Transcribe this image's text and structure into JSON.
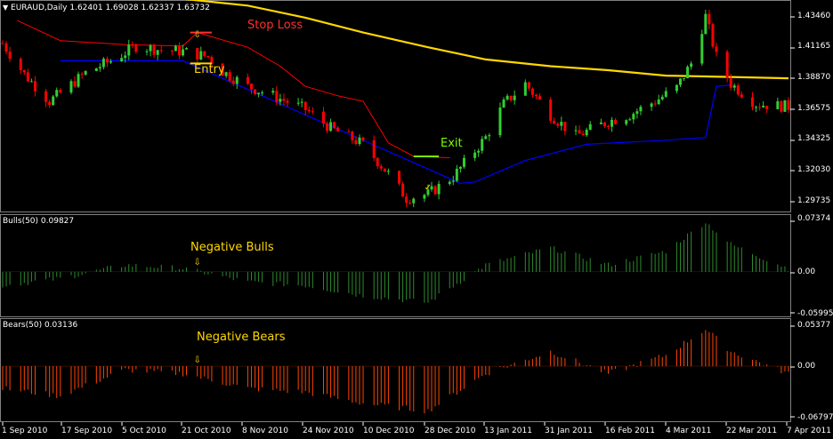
{
  "header": {
    "symbol_line": "EURAUD,Daily  1.62401 1.69028 1.62337 1.63732",
    "bulls_label": "Bulls(50) 0.09827",
    "bears_label": "Bears(50) 0.03136"
  },
  "annotations": {
    "stop_loss": "Stop Loss",
    "entry": "Entry",
    "exit": "Exit",
    "negative_bulls": "Negative Bulls",
    "negative_bears": "Negative Bears"
  },
  "price_axis": [
    "1.43460",
    "1.41165",
    "1.38870",
    "1.36575",
    "1.34325",
    "1.32030",
    "1.29735"
  ],
  "bulls_axis": [
    "0.07374",
    "0.00",
    "-0.05995"
  ],
  "bears_axis": [
    "0.05377",
    "0.00",
    "-0.06797"
  ],
  "time_axis": [
    "1 Sep 2010",
    "17 Sep 2010",
    "5 Oct 2010",
    "21 Oct 2010",
    "8 Nov 2010",
    "24 Nov 2010",
    "10 Dec 2010",
    "28 Dec 2010",
    "13 Jan 2011",
    "31 Jan 2011",
    "16 Feb 2011",
    "4 Mar 2011",
    "22 Mar 2011",
    "7 Apr 2011"
  ],
  "colors": {
    "background": "#000000",
    "grid_border": "#808080",
    "bull_candle": "#32cd32",
    "bear_candle": "#ff0000",
    "ma_line": "#ffd700",
    "stop_line": "#ff0000",
    "support_line": "#0000ff",
    "bulls_histogram": "#2e8b2e",
    "bears_histogram": "#ff4500",
    "annotation_yellow": "#ffd700",
    "annotation_red": "#ff3030",
    "annotation_green": "#7cfc00"
  },
  "chart_data": {
    "type": "candlestick",
    "symbol": "EURAUD",
    "timeframe": "Daily",
    "ohlc_header": {
      "open": 1.62401,
      "high": 1.69028,
      "low": 1.62337,
      "close": 1.63732
    },
    "price_path": [
      [
        "2010-09-01",
        1.415
      ],
      [
        "2010-09-07",
        1.392
      ],
      [
        "2010-09-14",
        1.372
      ],
      [
        "2010-09-17",
        1.378
      ],
      [
        "2010-09-24",
        1.393
      ],
      [
        "2010-10-01",
        1.402
      ],
      [
        "2010-10-05",
        1.408
      ],
      [
        "2010-10-08",
        1.413
      ],
      [
        "2010-10-15",
        1.41
      ],
      [
        "2010-10-21",
        1.409
      ],
      [
        "2010-10-28",
        1.405
      ],
      [
        "2010-11-01",
        1.394
      ],
      [
        "2010-11-08",
        1.383
      ],
      [
        "2010-11-15",
        1.376
      ],
      [
        "2010-11-24",
        1.366
      ],
      [
        "2010-12-01",
        1.352
      ],
      [
        "2010-12-10",
        1.34
      ],
      [
        "2010-12-17",
        1.318
      ],
      [
        "2010-12-22",
        1.3
      ],
      [
        "2010-12-28",
        1.303
      ],
      [
        "2011-01-04",
        1.316
      ],
      [
        "2011-01-13",
        1.345
      ],
      [
        "2011-01-18",
        1.37
      ],
      [
        "2011-01-24",
        1.385
      ],
      [
        "2011-01-31",
        1.362
      ],
      [
        "2011-02-07",
        1.346
      ],
      [
        "2011-02-16",
        1.357
      ],
      [
        "2011-02-22",
        1.362
      ],
      [
        "2011-03-01",
        1.372
      ],
      [
        "2011-03-07",
        1.382
      ],
      [
        "2011-03-11",
        1.4
      ],
      [
        "2011-03-15",
        1.435
      ],
      [
        "2011-03-18",
        1.405
      ],
      [
        "2011-03-22",
        1.385
      ],
      [
        "2011-03-29",
        1.37
      ],
      [
        "2011-04-07",
        1.368
      ]
    ],
    "moving_average_path": [
      [
        "2010-10-21",
        1.448
      ],
      [
        "2010-11-08",
        1.443
      ],
      [
        "2010-11-24",
        1.434
      ],
      [
        "2010-12-10",
        1.423
      ],
      [
        "2010-12-28",
        1.412
      ],
      [
        "2011-01-13",
        1.403
      ],
      [
        "2011-01-31",
        1.398
      ],
      [
        "2011-02-16",
        1.395
      ],
      [
        "2011-03-04",
        1.391
      ],
      [
        "2011-03-22",
        1.39
      ],
      [
        "2011-04-07",
        1.389
      ]
    ],
    "stop_trail_path": [
      [
        "2010-09-05",
        1.432
      ],
      [
        "2010-09-17",
        1.417
      ],
      [
        "2010-10-05",
        1.414
      ],
      [
        "2010-10-21",
        1.413
      ],
      [
        "2010-10-25",
        1.423
      ],
      [
        "2010-11-08",
        1.412
      ],
      [
        "2010-11-17",
        1.398
      ],
      [
        "2010-11-24",
        1.383
      ],
      [
        "2010-12-03",
        1.376
      ],
      [
        "2010-12-10",
        1.372
      ],
      [
        "2010-12-17",
        1.341
      ],
      [
        "2010-12-24",
        1.331
      ],
      [
        "2011-01-03",
        1.33
      ]
    ],
    "support_trail_path": [
      [
        "2010-09-17",
        1.402
      ],
      [
        "2010-10-21",
        1.402
      ],
      [
        "2011-01-06",
        1.311
      ],
      [
        "2011-01-10",
        1.312
      ],
      [
        "2011-01-24",
        1.328
      ],
      [
        "2011-02-10",
        1.34
      ],
      [
        "2011-03-04",
        1.343
      ],
      [
        "2011-03-15",
        1.345
      ],
      [
        "2011-03-18",
        1.383
      ],
      [
        "2011-03-22",
        1.384
      ]
    ],
    "levels": {
      "stop_loss": 1.423,
      "entry": 1.4,
      "exit": 1.331
    },
    "bulls_power": {
      "name": "Bulls(50)",
      "last": 0.09827,
      "ylim": [
        -0.05995,
        0.07374
      ],
      "path": [
        [
          "2010-09-01",
          -0.02
        ],
        [
          "2010-09-17",
          -0.01
        ],
        [
          "2010-10-05",
          0.01
        ],
        [
          "2010-10-21",
          0.005
        ],
        [
          "2010-11-08",
          -0.015
        ],
        [
          "2010-11-24",
          -0.02
        ],
        [
          "2010-12-10",
          -0.035
        ],
        [
          "2010-12-28",
          -0.045
        ],
        [
          "2011-01-13",
          0.01
        ],
        [
          "2011-01-31",
          0.035
        ],
        [
          "2011-02-16",
          0.01
        ],
        [
          "2011-03-04",
          0.03
        ],
        [
          "2011-03-15",
          0.073
        ],
        [
          "2011-03-22",
          0.04
        ],
        [
          "2011-04-07",
          0.005
        ]
      ]
    },
    "bears_power": {
      "name": "Bears(50)",
      "last": 0.03136,
      "ylim": [
        -0.06797,
        0.05377
      ],
      "path": [
        [
          "2010-09-01",
          -0.03
        ],
        [
          "2010-09-17",
          -0.04
        ],
        [
          "2010-10-05",
          -0.005
        ],
        [
          "2010-10-21",
          -0.01
        ],
        [
          "2010-11-08",
          -0.03
        ],
        [
          "2010-11-24",
          -0.035
        ],
        [
          "2010-12-10",
          -0.05
        ],
        [
          "2010-12-28",
          -0.06
        ],
        [
          "2011-01-13",
          -0.01
        ],
        [
          "2011-01-31",
          0.02
        ],
        [
          "2011-02-16",
          -0.01
        ],
        [
          "2011-03-04",
          0.015
        ],
        [
          "2011-03-15",
          0.05
        ],
        [
          "2011-03-22",
          0.02
        ],
        [
          "2011-04-07",
          -0.01
        ]
      ]
    }
  }
}
